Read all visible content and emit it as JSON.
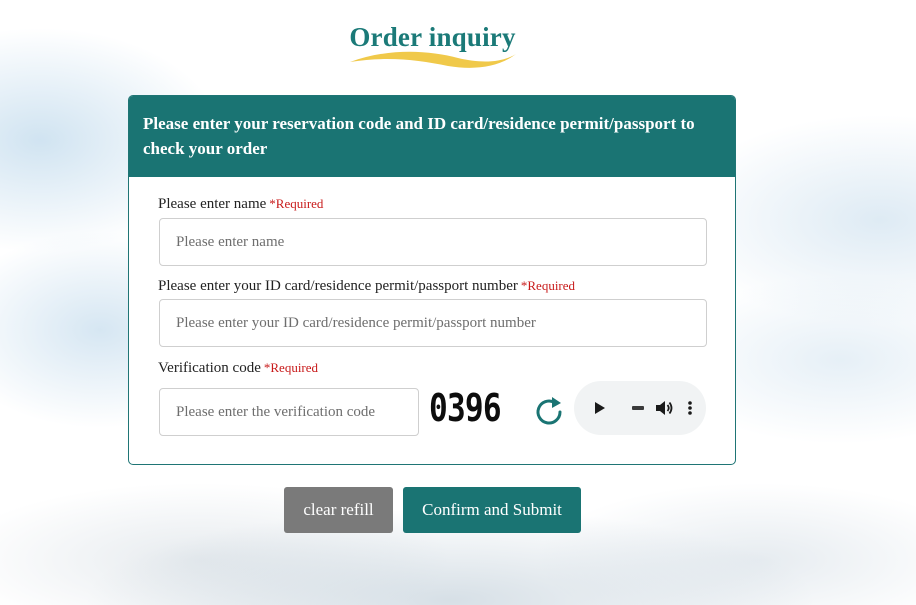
{
  "page": {
    "title": "Order inquiry"
  },
  "card": {
    "header": "Please enter your reservation code and ID card/residence permit/passport to check your order"
  },
  "required_text": "*Required",
  "fields": {
    "name": {
      "label": "Please enter name",
      "placeholder": "Please enter name",
      "value": ""
    },
    "id_number": {
      "label": "Please enter your ID card/residence permit/passport number",
      "placeholder": "Please enter your ID card/residence permit/passport number",
      "value": ""
    },
    "verification": {
      "label": "Verification code",
      "placeholder": "Please enter the verification code",
      "value": "",
      "captcha_text": "0396"
    }
  },
  "icons": {
    "refresh": "refresh-icon",
    "play": "play-icon",
    "volume": "volume-icon",
    "more": "more-vert-icon"
  },
  "buttons": {
    "clear": "clear refill",
    "submit": "Confirm and Submit"
  },
  "colors": {
    "accent": "#1a7473",
    "required": "#c81a1a",
    "swoosh": "#f0c94a",
    "clear_button": "#7a7a7a"
  }
}
